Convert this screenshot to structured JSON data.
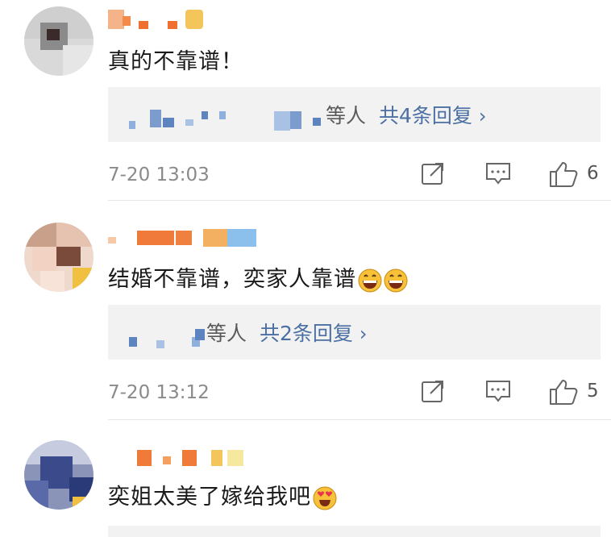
{
  "comments": [
    {
      "text": "真的不靠谱！",
      "reply_suffix": "等人",
      "reply_count": "共4条回复",
      "time": "7-20 13:03",
      "likes": "6"
    },
    {
      "text": "结婚不靠谱，奕家人靠谱",
      "reply_suffix": "等人",
      "reply_count": "共2条回复",
      "time": "7-20 13:12",
      "likes": "5"
    },
    {
      "text": "奕姐太美了嫁给我吧"
    }
  ],
  "icons": {
    "share": "share-icon",
    "comment": "comment-icon",
    "like": "thumbs-up-icon",
    "chevron": "chevron-right-icon",
    "emoji_laugh": "grinning-emoji-icon",
    "emoji_heart_eyes": "heart-eyes-emoji-icon"
  },
  "colors": {
    "link": "#4b6fa3",
    "meta": "#8a8a8a",
    "reply_bg": "#f2f2f2"
  }
}
